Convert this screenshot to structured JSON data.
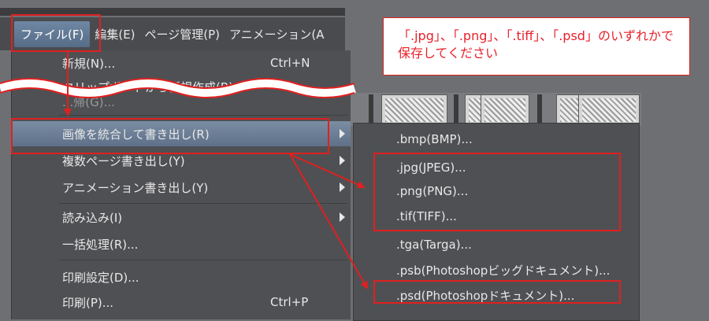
{
  "menubar": {
    "file": "ファイル(F)",
    "edit": "編集(E)",
    "page": "ページ管理(P)",
    "anim": "アニメーション(A"
  },
  "file_menu": {
    "new": "新規(N)...",
    "new_shortcut": "Ctrl+N",
    "new_from_clipboard": "クリップボードから新規作成(B)",
    "hidden_item": "...帰(G)...",
    "export_merged": "画像を統合して書き出し(R)",
    "export_multipage": "複数ページ書き出し(Y)",
    "export_animation": "アニメーション書き出し(Y)",
    "import": "読み込み(I)",
    "batch": "一括処理(R)...",
    "print_settings": "印刷設定(D)...",
    "print": "印刷(P)...",
    "print_shortcut": "Ctrl+P"
  },
  "submenu": [
    ".bmp(BMP)...",
    ".jpg(JPEG)...",
    ".png(PNG)...",
    ".tif(TIFF)...",
    ".tga(Targa)...",
    ".psb(Photoshopビッグドキュメント)...",
    ".psd(Photoshopドキュメント)..."
  ],
  "note": {
    "line1": "「.jpg」、「.png」、「.tiff」、「.psd」のいずれかで",
    "line2": "保存してください"
  },
  "colors": {
    "annotation": "#e02020",
    "menu_bg": "#4f5053",
    "highlight": "#6f87a3"
  }
}
